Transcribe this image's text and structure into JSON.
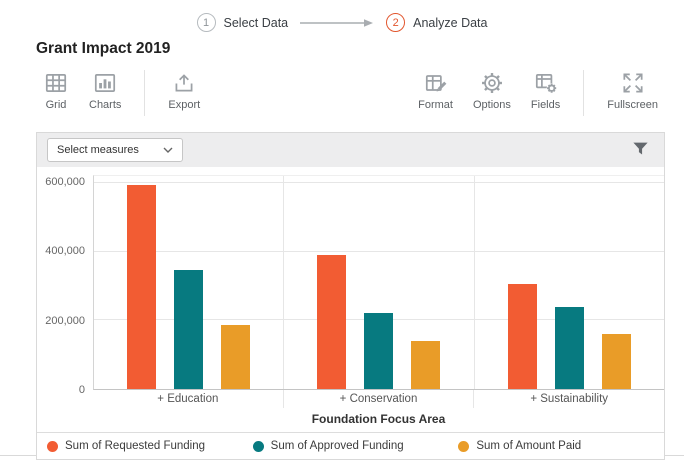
{
  "stepper": {
    "steps": [
      {
        "number": "1",
        "label": "Select Data"
      },
      {
        "number": "2",
        "label": "Analyze Data"
      }
    ]
  },
  "title": "Grant Impact 2019",
  "toolbar": {
    "grid_label": "Grid",
    "charts_label": "Charts",
    "export_label": "Export",
    "format_label": "Format",
    "options_label": "Options",
    "fields_label": "Fields",
    "fullscreen_label": "Fullscreen"
  },
  "measures": {
    "select_label": "Select measures"
  },
  "chart_data": {
    "type": "bar",
    "title": "",
    "categories": [
      "+ Education",
      "+ Conservation",
      "+ Sustainability"
    ],
    "series": [
      {
        "name": "Sum of Requested Funding",
        "color": "#F25C33",
        "values": [
          595000,
          390000,
          305000
        ]
      },
      {
        "name": "Sum of Approved Funding",
        "color": "#077A80",
        "values": [
          345000,
          220000,
          240000
        ]
      },
      {
        "name": "Sum of Amount Paid",
        "color": "#E99C28",
        "values": [
          185000,
          140000,
          160000
        ]
      }
    ],
    "xlabel": "Foundation Focus Area",
    "ylabel": "",
    "ylim": [
      0,
      620000
    ],
    "yticks": [
      0,
      200000,
      400000,
      600000
    ],
    "grid": true,
    "legend_position": "bottom"
  },
  "colors": {
    "accent": "#E2572F",
    "requested": "#F25C33",
    "approved": "#077A80",
    "paid": "#E99C28"
  }
}
